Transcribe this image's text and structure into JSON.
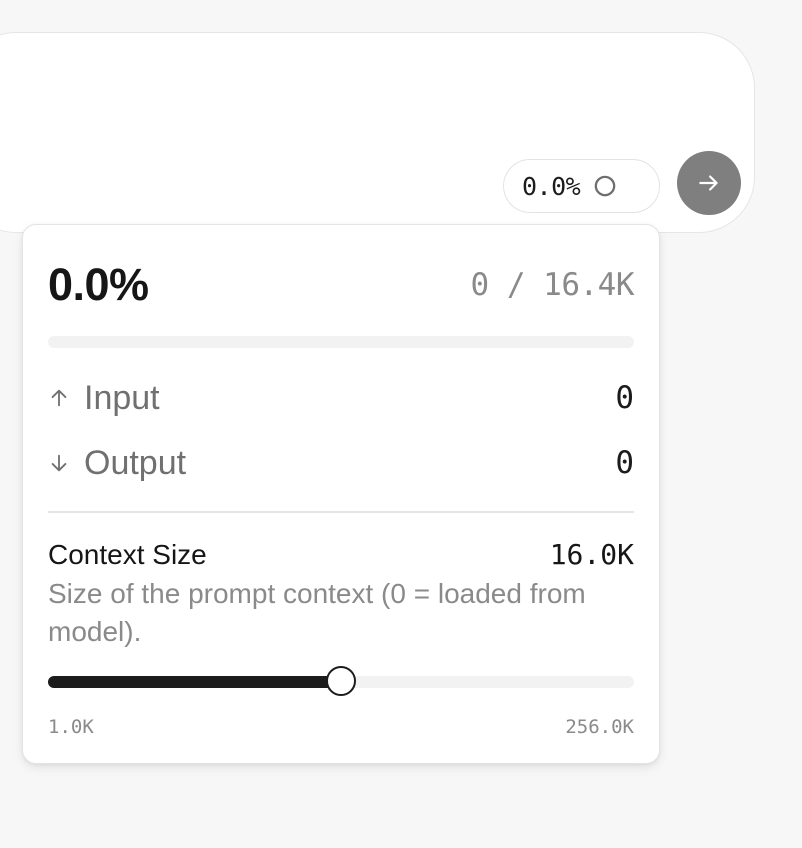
{
  "composer": {
    "usage_pill": {
      "percent_label": "0.0%",
      "icon": "ring-icon"
    },
    "send_button": {
      "icon": "arrow-right-icon",
      "color": "#7f7f7f"
    }
  },
  "context_popover": {
    "usage_percent_label": "0.0%",
    "usage_fraction": 0.0,
    "token_count_label": "0 / 16.4K",
    "rows": {
      "input": {
        "icon": "arrow-up-icon",
        "label": "Input",
        "value": "0"
      },
      "output": {
        "icon": "arrow-down-icon",
        "label": "Output",
        "value": "0"
      }
    },
    "context_size": {
      "title": "Context Size",
      "value_label": "16.0K",
      "description": "Size of the prompt context (0 = loaded from model).",
      "slider": {
        "min_label": "1.0K",
        "max_label": "256.0K",
        "min": 1.0,
        "max": 256.0,
        "value": 16.0,
        "unit": "K"
      }
    }
  },
  "colors": {
    "accent": "#1c1c1c",
    "muted_text": "#8a8a8a",
    "track": "#f2f2f2"
  }
}
